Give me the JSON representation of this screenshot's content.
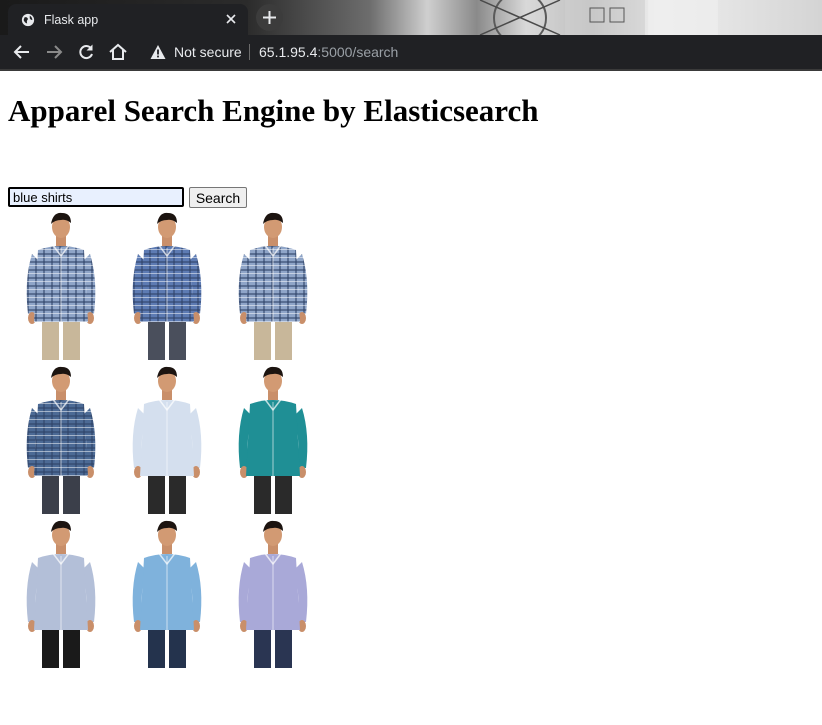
{
  "browser": {
    "tab_title": "Flask app",
    "omnibox": {
      "security_label": "Not secure",
      "url_host": "65.1.95.4",
      "url_rest": ":5000/search"
    }
  },
  "page": {
    "title": "Apparel Search Engine by Elasticsearch",
    "search": {
      "value": "blue shirts",
      "button_label": "Search"
    },
    "results": [
      {
        "shirt": "#8fa5c8",
        "pattern": "check",
        "pants": "#c8b79a"
      },
      {
        "shirt": "#5d7bb3",
        "pattern": "check",
        "pants": "#4a4f5c"
      },
      {
        "shirt": "#8fa5c8",
        "pattern": "check",
        "pants": "#c8b79a"
      },
      {
        "shirt": "#4c6a95",
        "pattern": "check",
        "pants": "#3b3f4a"
      },
      {
        "shirt": "#d4dfee",
        "pattern": "solid",
        "pants": "#2a2a2a"
      },
      {
        "shirt": "#1f8f95",
        "pattern": "solid",
        "pants": "#2a2a2a"
      },
      {
        "shirt": "#b3bfd8",
        "pattern": "solid",
        "pants": "#1a1a1a"
      },
      {
        "shirt": "#7fb2dc",
        "pattern": "solid",
        "pants": "#24334d"
      },
      {
        "shirt": "#a9a9d8",
        "pattern": "solid",
        "pants": "#2a3552"
      }
    ]
  }
}
